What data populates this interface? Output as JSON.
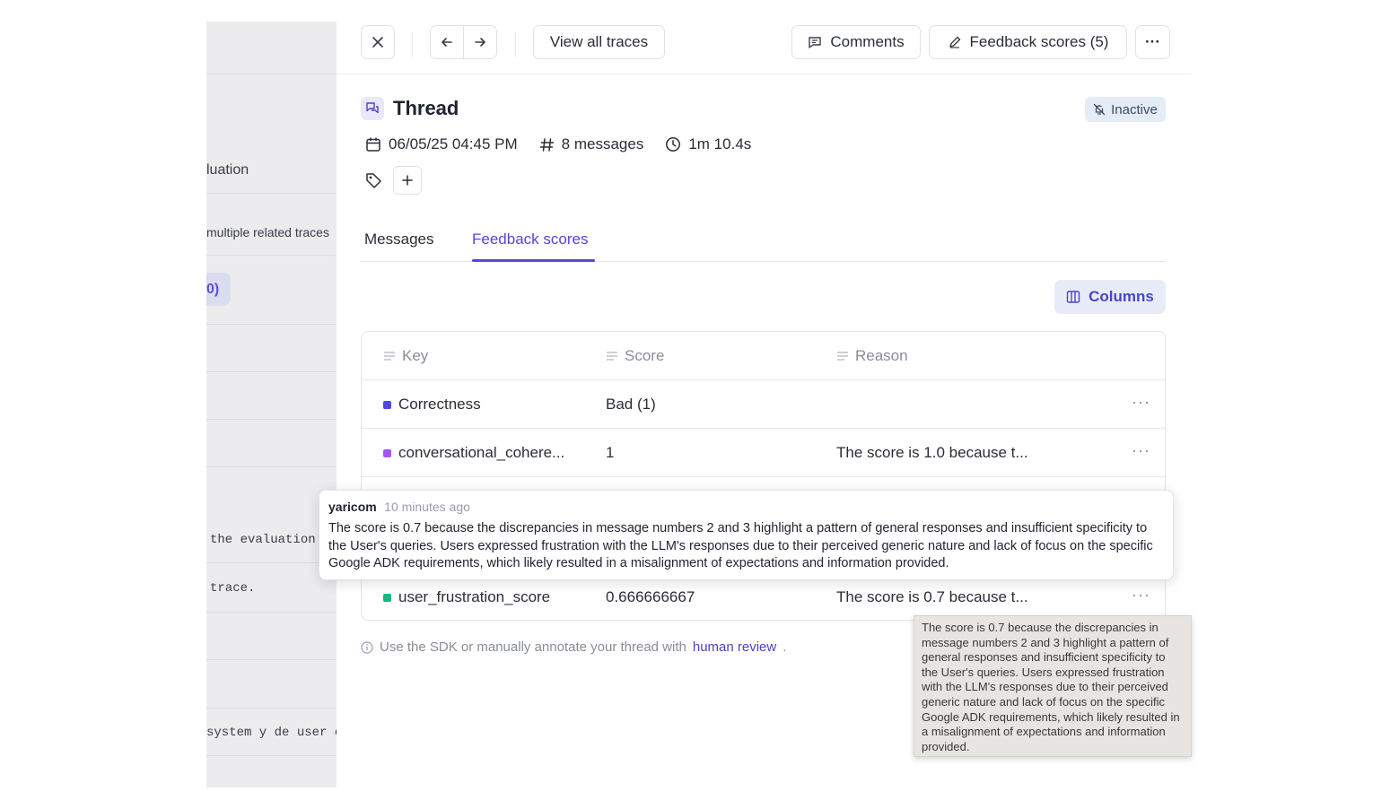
{
  "background": {
    "items": [
      {
        "text": "luation",
        "mono": false
      },
      {
        "text": "multiple related traces",
        "mono": false
      },
      {
        "text": "0)",
        "mono": false
      },
      {
        "text": "the evaluation",
        "mono": true
      },
      {
        "text": "trace.",
        "mono": true
      },
      {
        "text": "system y de user e",
        "mono": true
      }
    ]
  },
  "toolbar": {
    "view_all_label": "View all traces",
    "comments_label": "Comments",
    "feedback_label": "Feedback scores (5)",
    "more_label": "···"
  },
  "thread": {
    "title": "Thread",
    "status": "Inactive",
    "date": "06/05/25 04:45 PM",
    "messages": "8 messages",
    "duration": "1m 10.4s"
  },
  "tabs": [
    {
      "label": "Messages",
      "active": false
    },
    {
      "label": "Feedback scores",
      "active": true
    }
  ],
  "columns_label": "Columns",
  "table": {
    "headers": {
      "key": "Key",
      "score": "Score",
      "reason": "Reason"
    },
    "rows": [
      {
        "key": "Correctness",
        "score": "Bad (1)",
        "reason": "",
        "color": "#4f46e5"
      },
      {
        "key": "conversational_cohere...",
        "score": "1",
        "reason": "The score is 1.0 because t...",
        "color": "#a855f7"
      },
      {
        "key": "user_frustration_score",
        "score": "0.666666667",
        "reason": "The score is 0.7 because t...",
        "color": "#10b981"
      }
    ]
  },
  "footer": {
    "text": "Use the SDK or manually annotate your thread with",
    "link": "human review",
    "end": "."
  },
  "popover": {
    "author": "yaricom",
    "time": "10 minutes ago",
    "text": "The score is 0.7 because the discrepancies in message numbers 2 and 3 highlight a pattern of general responses and insufficient specificity to the User's queries. Users expressed frustration with the LLM's responses due to their perceived generic nature and lack of focus on the specific Google ADK requirements, which likely resulted in a misalignment of expectations and information provided."
  },
  "tooltip": {
    "text": "The score is 0.7 because the discrepancies in message numbers 2 and 3 highlight a pattern of general responses and insufficient specificity to the User's queries. Users expressed frustration with the LLM's responses due to their perceived generic nature and lack of focus on the specific Google ADK requirements, which likely resulted in a misalignment of expectations and information provided."
  }
}
